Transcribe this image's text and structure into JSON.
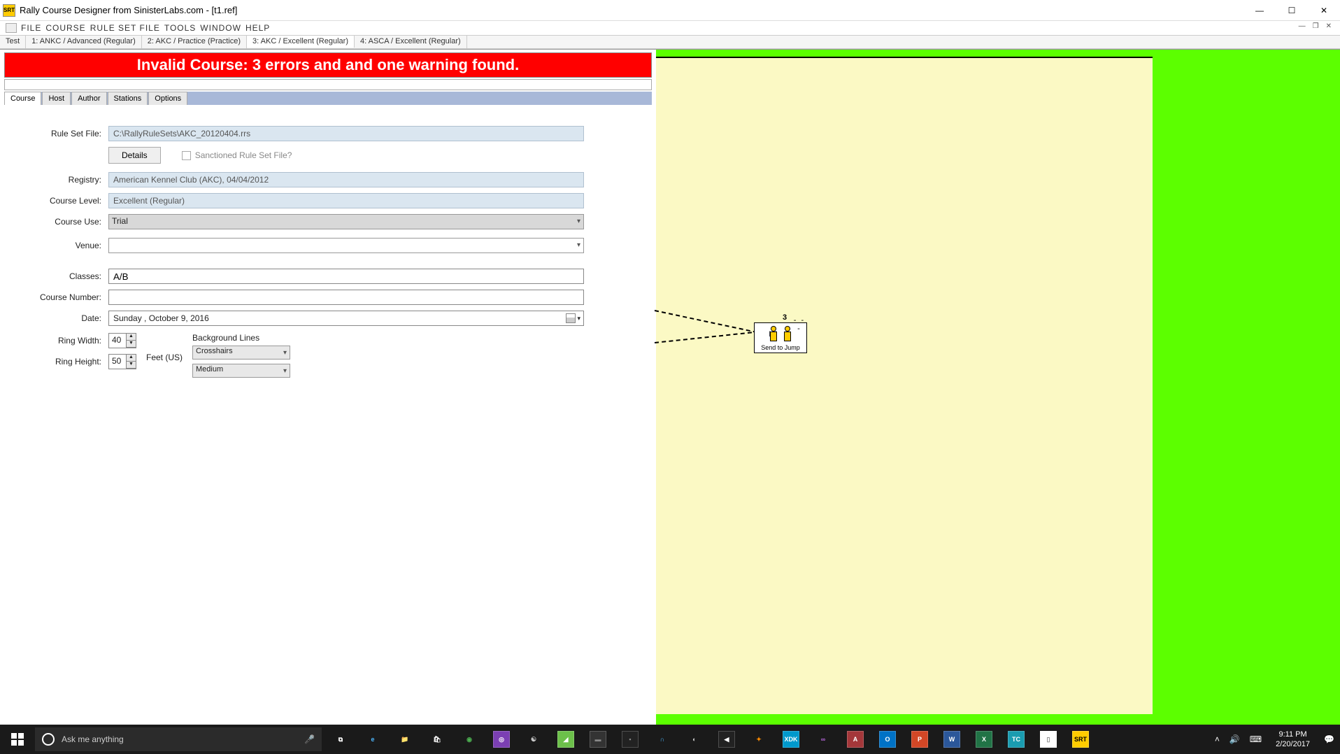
{
  "titlebar": {
    "icon_text": "SRT",
    "title": "Rally Course Designer from SinisterLabs.com - [t1.ref]"
  },
  "menubar": {
    "items": [
      "FILE",
      "COURSE",
      "RULE SET FILE",
      "TOOLS",
      "WINDOW",
      "HELP"
    ]
  },
  "subtabs": {
    "items": [
      {
        "label": "Test"
      },
      {
        "label": "1: ANKC / Advanced (Regular)"
      },
      {
        "label": "2: AKC / Practice (Practice)"
      },
      {
        "label": "3: AKC / Excellent (Regular)",
        "active": true
      },
      {
        "label": "4: ASCA / Excellent (Regular)"
      }
    ]
  },
  "error_banner": "Invalid Course: 3 errors and and one warning found.",
  "inner_tabs": [
    "Course",
    "Host",
    "Author",
    "Stations",
    "Options"
  ],
  "form": {
    "rule_set_file_label": "Rule Set File:",
    "rule_set_file_value": "C:\\RallyRuleSets\\AKC_20120404.rrs",
    "details_btn": "Details",
    "sanctioned_label": "Sanctioned Rule Set File?",
    "registry_label": "Registry:",
    "registry_value": "American Kennel Club (AKC), 04/04/2012",
    "course_level_label": "Course Level:",
    "course_level_value": "Excellent (Regular)",
    "course_use_label": "Course Use:",
    "course_use_value": "Trial",
    "venue_label": "Venue:",
    "venue_value": "",
    "classes_label": "Classes:",
    "classes_value": "A/B",
    "course_number_label": "Course Number:",
    "course_number_value": "",
    "date_label": "Date:",
    "date_value": "Sunday   ,   October     9, 2016",
    "ring_width_label": "Ring Width:",
    "ring_width_value": "40",
    "ring_height_label": "Ring Height:",
    "ring_height_value": "50",
    "unit_label": "Feet (US)",
    "bg_lines_label": "Background Lines",
    "bg_select1": "Crosshairs",
    "bg_select2": "Medium"
  },
  "station": {
    "number": "3",
    "caption": "Send to Jump"
  },
  "taskbar": {
    "search_placeholder": "Ask me anything",
    "time": "9:11 PM",
    "date": "2/20/2017",
    "apps": [
      {
        "name": "task-view",
        "glyph": "⧉",
        "bg": "transparent",
        "fg": "#fff"
      },
      {
        "name": "edge",
        "glyph": "e",
        "bg": "transparent",
        "fg": "#4db8ff"
      },
      {
        "name": "file-explorer",
        "glyph": "📁",
        "bg": "transparent",
        "fg": "#ffcc44"
      },
      {
        "name": "store",
        "glyph": "🛍",
        "bg": "transparent",
        "fg": "#fff"
      },
      {
        "name": "chrome",
        "glyph": "◉",
        "bg": "transparent",
        "fg": "#4caf50"
      },
      {
        "name": "gog",
        "glyph": "◎",
        "bg": "#7b3fb3",
        "fg": "#fff"
      },
      {
        "name": "app7",
        "glyph": "☯",
        "bg": "transparent",
        "fg": "#ccc"
      },
      {
        "name": "app8",
        "glyph": "◢",
        "bg": "#6cc04a",
        "fg": "#fff"
      },
      {
        "name": "cmd",
        "glyph": "▬",
        "bg": "#333",
        "fg": "#888"
      },
      {
        "name": "app10",
        "glyph": "▪",
        "bg": "#222",
        "fg": "#888"
      },
      {
        "name": "app11",
        "glyph": "∩",
        "bg": "transparent",
        "fg": "#4db8ff"
      },
      {
        "name": "app12",
        "glyph": "◐",
        "bg": "transparent",
        "fg": "#ccc"
      },
      {
        "name": "unity",
        "glyph": "◀",
        "bg": "#222",
        "fg": "#fff"
      },
      {
        "name": "blender",
        "glyph": "✦",
        "bg": "transparent",
        "fg": "#ff8c00"
      },
      {
        "name": "xdk",
        "glyph": "XDK",
        "bg": "#0099cc",
        "fg": "#fff"
      },
      {
        "name": "visual-studio",
        "glyph": "∞",
        "bg": "transparent",
        "fg": "#b565d8"
      },
      {
        "name": "access",
        "glyph": "A",
        "bg": "#a4373a",
        "fg": "#fff"
      },
      {
        "name": "outlook",
        "glyph": "O",
        "bg": "#0072c6",
        "fg": "#fff"
      },
      {
        "name": "powerpoint",
        "glyph": "P",
        "bg": "#d24726",
        "fg": "#fff"
      },
      {
        "name": "word",
        "glyph": "W",
        "bg": "#2b579a",
        "fg": "#fff"
      },
      {
        "name": "excel",
        "glyph": "X",
        "bg": "#217346",
        "fg": "#fff"
      },
      {
        "name": "teamcity",
        "glyph": "TC",
        "bg": "#1a9cb0",
        "fg": "#fff"
      },
      {
        "name": "notepad",
        "glyph": "▯",
        "bg": "#fff",
        "fg": "#888"
      },
      {
        "name": "rally-app",
        "glyph": "SRT",
        "bg": "#ffcc00",
        "fg": "#000"
      }
    ]
  }
}
